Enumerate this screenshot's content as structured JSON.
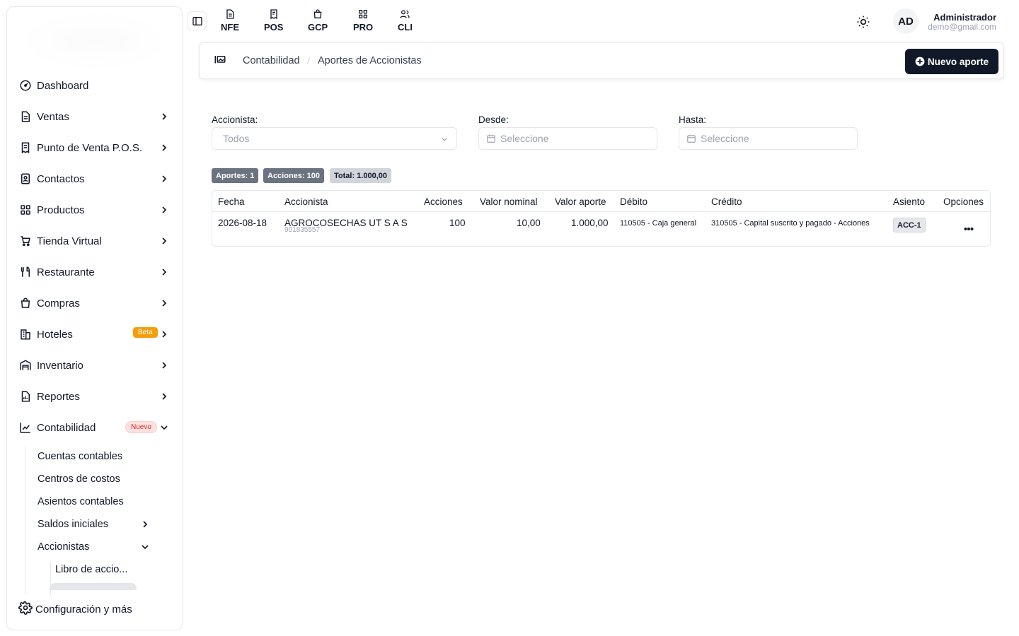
{
  "sidebar": {
    "items": [
      {
        "label": "Dashboard",
        "icon": "gauge-icon"
      },
      {
        "label": "Ventas",
        "icon": "document-icon"
      },
      {
        "label": "Punto de Venta P.O.S.",
        "icon": "pos-icon"
      },
      {
        "label": "Contactos",
        "icon": "contacts-icon"
      },
      {
        "label": "Productos",
        "icon": "grid-icon"
      },
      {
        "label": "Tienda Virtual",
        "icon": "cart-icon"
      },
      {
        "label": "Restaurante",
        "icon": "utensils-icon"
      },
      {
        "label": "Compras",
        "icon": "bag-icon"
      },
      {
        "label": "Hoteles",
        "icon": "building-icon",
        "badge": "Beta"
      },
      {
        "label": "Inventario",
        "icon": "warehouse-icon"
      },
      {
        "label": "Reportes",
        "icon": "report-icon"
      },
      {
        "label": "Contabilidad",
        "icon": "chart-icon",
        "badge": "Nuevo"
      }
    ],
    "submenu": {
      "cuentas": "Cuentas contables",
      "centros": "Centros de costos",
      "asientos": "Asientos contables",
      "saldos": "Saldos iniciales",
      "accionistas": "Accionistas",
      "libro": "Libro de accio..."
    },
    "config_label": "Configuración y más"
  },
  "topnav": [
    {
      "label": "NFE",
      "icon": "invoice-icon"
    },
    {
      "label": "POS",
      "icon": "pos-receipt-icon"
    },
    {
      "label": "GCP",
      "icon": "shopping-bag-icon"
    },
    {
      "label": "PRO",
      "icon": "products-grid-icon"
    },
    {
      "label": "CLI",
      "icon": "users-icon"
    }
  ],
  "user": {
    "initials": "AD",
    "name": "Administrador",
    "email": "demo@gmail.com"
  },
  "breadcrumb": {
    "parent": "Contabilidad",
    "current": "Aportes de Accionistas"
  },
  "new_button": "Nuevo aporte",
  "filters": {
    "accionista_label": "Accionista:",
    "accionista_value": "Todos",
    "desde_label": "Desde:",
    "desde_placeholder": "Seleccione",
    "hasta_label": "Hasta:",
    "hasta_placeholder": "Seleccione"
  },
  "summary": {
    "aportes": "Aportes: 1",
    "acciones": "Acciones: 100",
    "total": "Total: 1.000,00"
  },
  "table": {
    "headers": [
      "Fecha",
      "Accionista",
      "Acciones",
      "Valor nominal",
      "Valor aporte",
      "Débito",
      "Crédito",
      "Asiento",
      "Opciones"
    ],
    "rows": [
      {
        "fecha": "2026-08-18",
        "accionista": "AGROCOSECHAS UT S A S",
        "nit": "901835557",
        "acciones": "100",
        "valor_nominal": "10,00",
        "valor_aporte": "1.000,00",
        "debito": "110505 - Caja general",
        "credito": "310505 - Capital suscrito y pagado - Acciones",
        "asiento": "ACC-1"
      }
    ]
  },
  "colors": {
    "primary": "#111827",
    "beta": "#f59e0b",
    "nuevo": "#dc2626",
    "border": "#e5e7eb"
  }
}
